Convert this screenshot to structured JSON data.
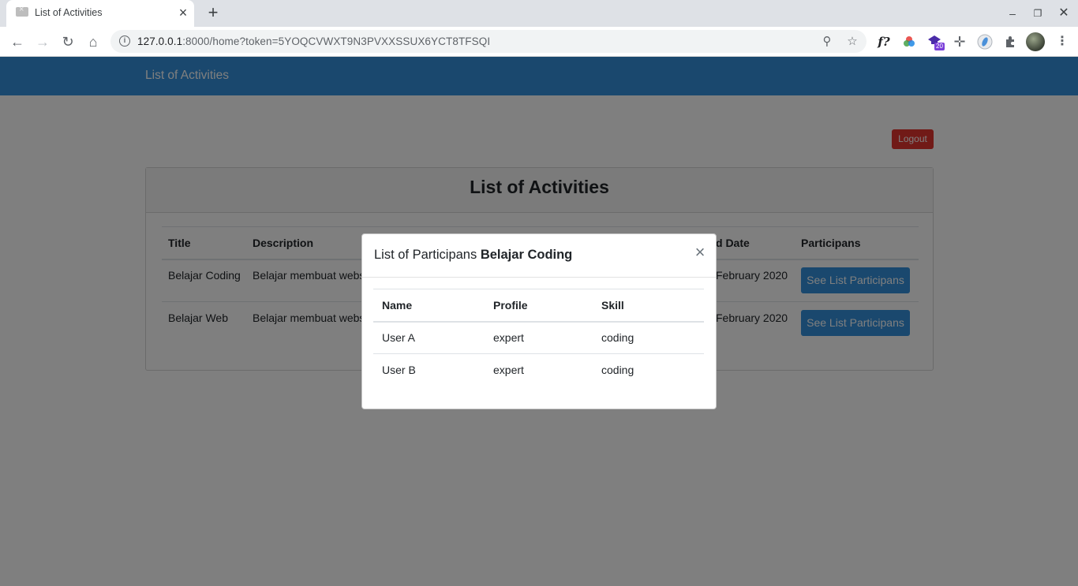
{
  "browser": {
    "tab_title": "List of Activities",
    "url_host": "127.0.0.1",
    "url_rest": ":8000/home?token=5YOQCVWXT9N3PVXXSSUX6YCT8TFSQI",
    "extension_badge": "20",
    "extension_fx": "f?"
  },
  "navbar": {
    "brand": "List of Activities"
  },
  "page": {
    "logout_label": "Logout"
  },
  "card": {
    "title": "List of Activities",
    "columns": [
      "Title",
      "Description",
      "d Date",
      "Participans"
    ],
    "rows": [
      {
        "title": "Belajar Coding",
        "description": "Belajar membuat websi",
        "date": "February 2020",
        "action": "See List Participans"
      },
      {
        "title": "Belajar Web",
        "description": "Belajar membuat websi",
        "date": "February 2020",
        "action": "See List Participans"
      }
    ]
  },
  "modal": {
    "title_prefix": "List of Participans",
    "title_activity": "Belajar Coding",
    "close_label": "×",
    "columns": [
      "Name",
      "Profile",
      "Skill"
    ],
    "rows": [
      {
        "name": "User A",
        "profile": "expert",
        "skill": "coding"
      },
      {
        "name": "User B",
        "profile": "expert",
        "skill": "coding"
      }
    ]
  }
}
